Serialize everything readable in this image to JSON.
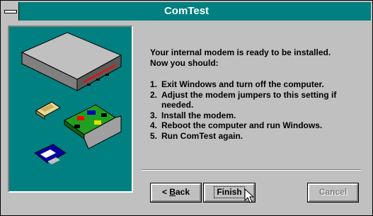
{
  "window": {
    "title": "ComTest"
  },
  "content": {
    "intro_line1": "Your internal modem is ready to be installed.",
    "intro_line2": "Now you should:",
    "steps": [
      {
        "num": "1.",
        "text": "Exit Windows and turn off the computer."
      },
      {
        "num": "2.",
        "text": "Adjust the modem jumpers to this setting if needed."
      },
      {
        "num": "3.",
        "text": "Install the modem."
      },
      {
        "num": "4.",
        "text": "Reboot the computer and run Windows."
      },
      {
        "num": "5.",
        "text": "Run ComTest again."
      }
    ]
  },
  "buttons": {
    "back_prefix": "< ",
    "back_mnemonic": "B",
    "back_rest": "ack",
    "finish_label": "Finish",
    "cancel_label": "Cancel"
  },
  "colors": {
    "panel": "#008080",
    "titlebar": "#008080",
    "face": "#c0c0c0"
  },
  "icons": [
    "system-menu-icon",
    "modem-icon",
    "chip-icon",
    "expansion-card-icon",
    "floppy-disk-icon",
    "mouse-cursor-icon"
  ]
}
